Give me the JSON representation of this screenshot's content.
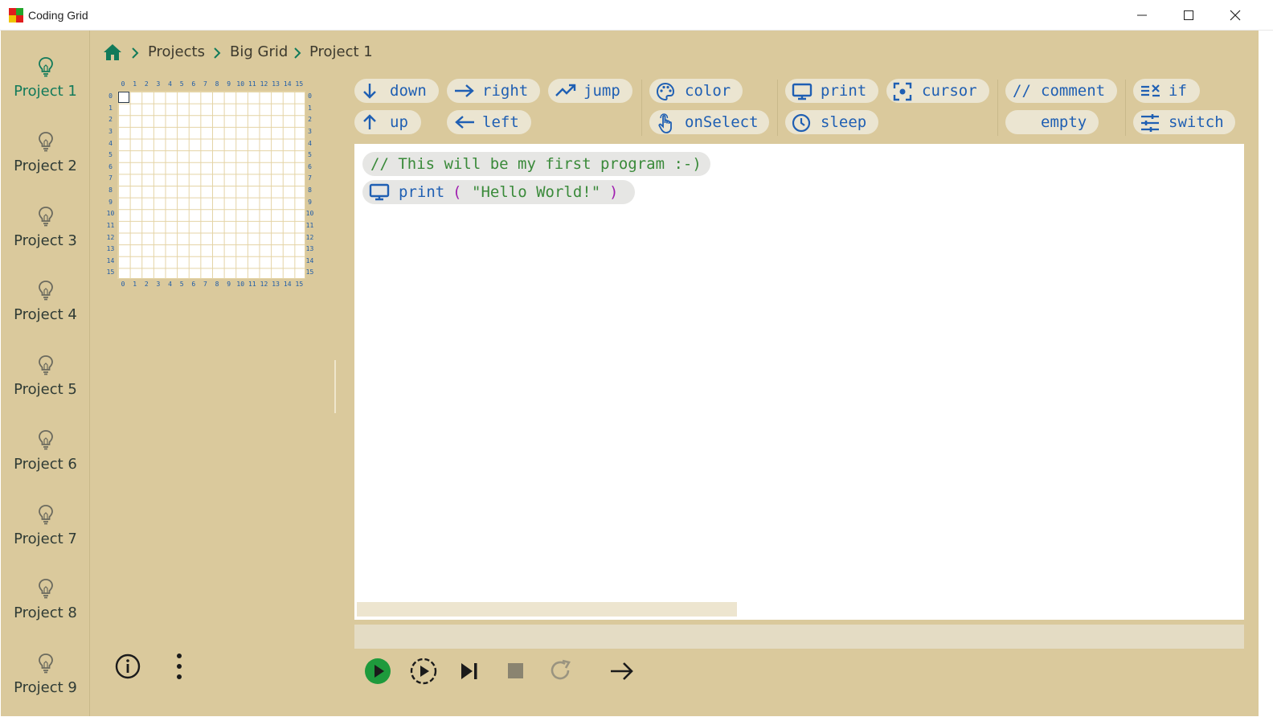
{
  "window": {
    "title": "Coding Grid",
    "icon_colors": [
      "#e11d1d",
      "#22a52a",
      "#f0c400",
      "#1d5fd1"
    ]
  },
  "sidebar": {
    "projects": [
      {
        "label": "Project 1",
        "icon": "lightbulb-icon",
        "active": true
      },
      {
        "label": "Project 2",
        "icon": "lightbulb-icon"
      },
      {
        "label": "Project 3",
        "icon": "lightbulb-icon"
      },
      {
        "label": "Project 4",
        "icon": "lightbulb-icon"
      },
      {
        "label": "Project 5",
        "icon": "lightbulb-icon"
      },
      {
        "label": "Project 6",
        "icon": "lightbulb-icon"
      },
      {
        "label": "Project 7",
        "icon": "lightbulb-icon"
      },
      {
        "label": "Project 8",
        "icon": "lightbulb-icon"
      },
      {
        "label": "Project 9",
        "icon": "lightbulb-icon"
      }
    ]
  },
  "breadcrumb": {
    "home_icon": "home-icon",
    "items": [
      "Projects",
      "Big Grid",
      "Project 1"
    ]
  },
  "grid": {
    "columns": [
      "0",
      "1",
      "2",
      "3",
      "4",
      "5",
      "6",
      "7",
      "8",
      "9",
      "10",
      "11",
      "12",
      "13",
      "14",
      "15"
    ],
    "rows": [
      "0",
      "1",
      "2",
      "3",
      "4",
      "5",
      "6",
      "7",
      "8",
      "9",
      "10",
      "11",
      "12",
      "13",
      "14",
      "15"
    ],
    "selected_cell": [
      0,
      0
    ]
  },
  "palette": {
    "down": "down",
    "right": "right",
    "jump": "jump",
    "up": "up",
    "left": "left",
    "color": "color",
    "onSelect": "onSelect",
    "print": "print",
    "cursor": "cursor",
    "sleep": "sleep",
    "comment_prefix": "//",
    "comment": "comment",
    "empty": "empty",
    "if": "if",
    "switch": "switch"
  },
  "program": {
    "comment_line": "// This will be my first program :-)",
    "print_keyword": "print",
    "open_paren": "(",
    "string_arg": "\"Hello World!\"",
    "close_paren": ")"
  },
  "controls": [
    "run-icon",
    "step-run-icon",
    "step-next-icon",
    "stop-icon",
    "restart-icon",
    "arrow-right-icon"
  ],
  "colors": {
    "background": "#dac99c",
    "accent_green": "#127a5a",
    "keyword_blue": "#1f5fb3",
    "comment_green": "#3a8a3a",
    "paren_purple": "#a020b0",
    "run_green": "#1e9a3c"
  }
}
